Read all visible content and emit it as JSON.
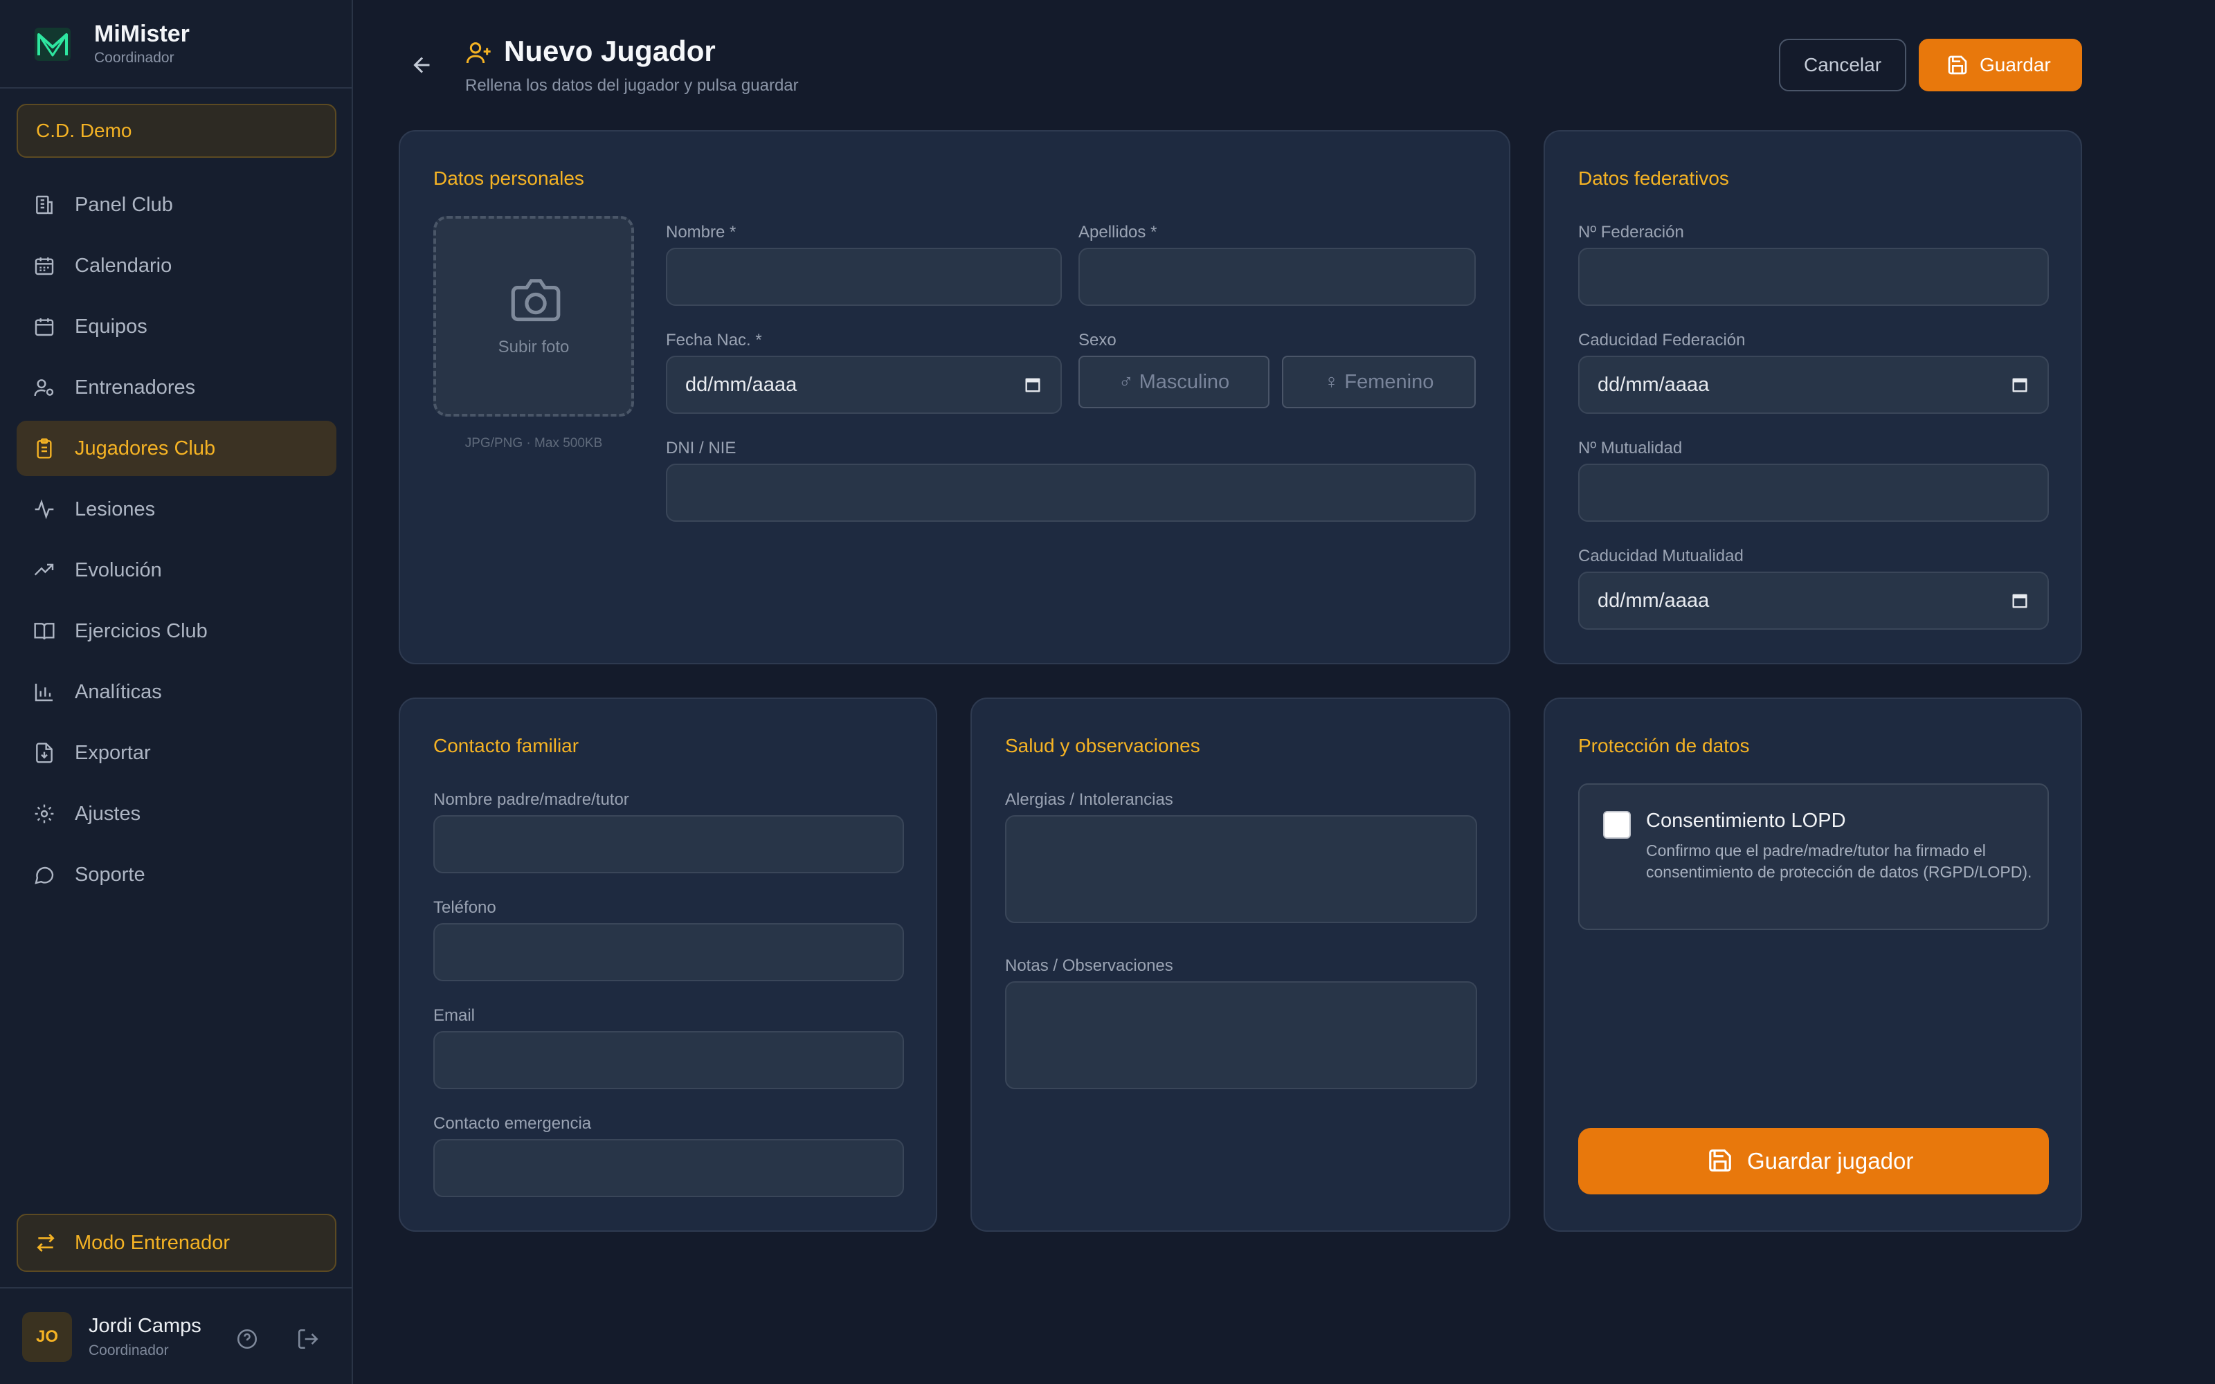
{
  "brand": {
    "name": "MiMister",
    "role": "Coordinador"
  },
  "club": {
    "name": "C.D. Demo"
  },
  "nav": [
    {
      "label": "Panel Club",
      "icon": "building-icon"
    },
    {
      "label": "Calendario",
      "icon": "calendar-icon"
    },
    {
      "label": "Equipos",
      "icon": "calendar-icon"
    },
    {
      "label": "Entrenadores",
      "icon": "user-gear-icon"
    },
    {
      "label": "Jugadores Club",
      "icon": "clipboard-icon",
      "active": true
    },
    {
      "label": "Lesiones",
      "icon": "activity-icon"
    },
    {
      "label": "Evolución",
      "icon": "trending-up-icon"
    },
    {
      "label": "Ejercicios Club",
      "icon": "book-icon"
    },
    {
      "label": "Analíticas",
      "icon": "bar-chart-icon"
    },
    {
      "label": "Exportar",
      "icon": "file-download-icon"
    },
    {
      "label": "Ajustes",
      "icon": "gear-icon"
    },
    {
      "label": "Soporte",
      "icon": "chat-icon"
    }
  ],
  "mode_button": {
    "label": "Modo Entrenador"
  },
  "user": {
    "initials": "JO",
    "name": "Jordi Camps",
    "role": "Coordinador"
  },
  "header": {
    "title": "Nuevo Jugador",
    "subtitle": "Rellena los datos del jugador y pulsa guardar",
    "cancel_label": "Cancelar",
    "save_label": "Guardar"
  },
  "personal": {
    "title": "Datos personales",
    "photo_label": "Subir foto",
    "photo_hint": "JPG/PNG · Max 500KB",
    "nombre_label": "Nombre *",
    "apellidos_label": "Apellidos *",
    "fecha_label": "Fecha Nac. *",
    "fecha_value": "dd/mm/aaaa",
    "sexo_label": "Sexo",
    "sexo_male": "♂ Masculino",
    "sexo_female": "♀ Femenino",
    "dni_label": "DNI / NIE"
  },
  "federativo": {
    "title": "Datos federativos",
    "fed_num_label": "Nº Federación",
    "fed_exp_label": "Caducidad Federación",
    "fed_exp_value": "dd/mm/aaaa",
    "mut_num_label": "Nº Mutualidad",
    "mut_exp_label": "Caducidad Mutualidad",
    "mut_exp_value": "dd/mm/aaaa"
  },
  "contacto": {
    "title": "Contacto familiar",
    "tutor_label": "Nombre padre/madre/tutor",
    "telefono_label": "Teléfono",
    "email_label": "Email",
    "emergencia_label": "Contacto emergencia"
  },
  "salud": {
    "title": "Salud y observaciones",
    "alergias_label": "Alergias / Intolerancias",
    "notas_label": "Notas / Observaciones"
  },
  "proteccion": {
    "title": "Protección de datos",
    "consent_title": "Consentimiento LOPD",
    "consent_text": "Confirmo que el padre/madre/tutor ha firmado el consentimiento de protección de datos (RGPD/LOPD).",
    "save_player_label": "Guardar jugador"
  },
  "colors": {
    "accent": "#f5b324",
    "primary_button": "#e8780c",
    "background": "#141b2b",
    "card": "#1e2a40"
  }
}
